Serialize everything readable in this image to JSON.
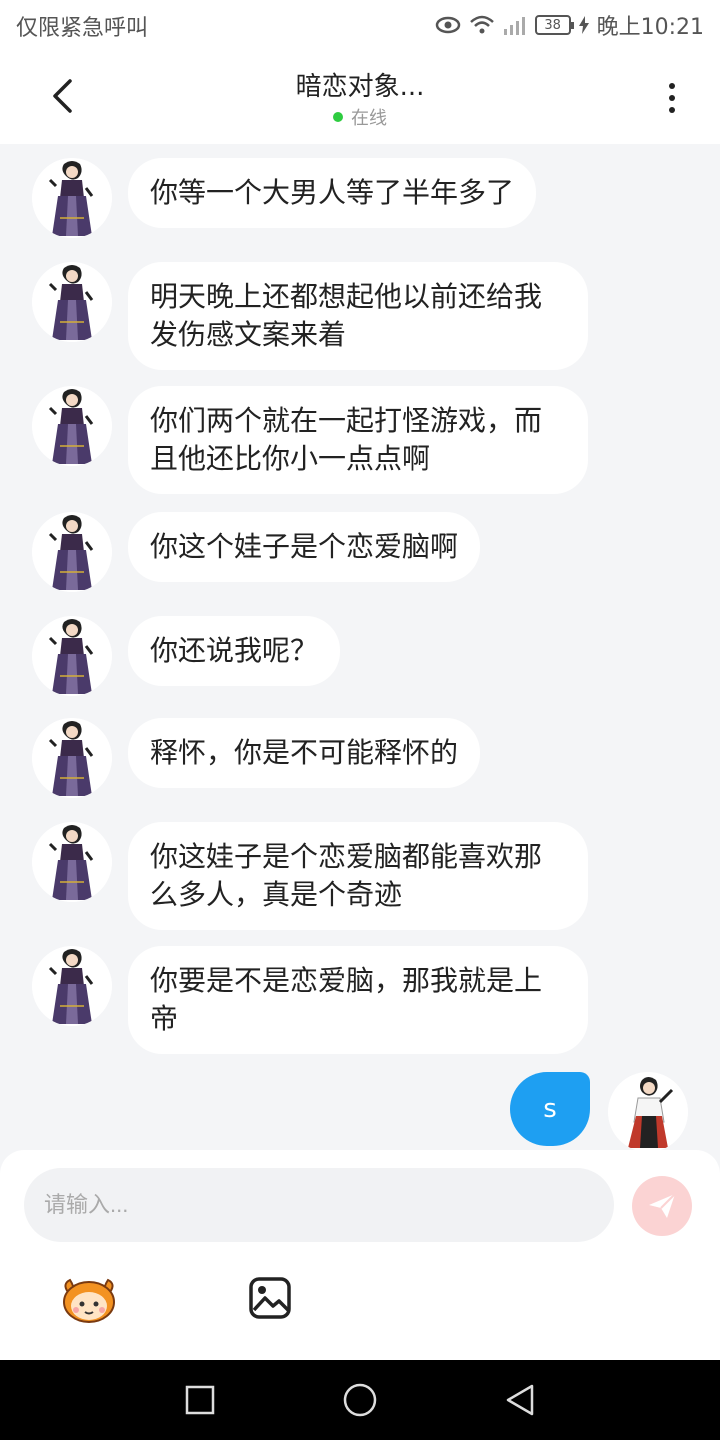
{
  "status_bar": {
    "left_text": "仅限紧急呼叫",
    "battery": "38",
    "time": "晚上10:21"
  },
  "header": {
    "title": "暗恋对象...",
    "status": "在线",
    "status_color": "#2ecc40"
  },
  "messages": [
    {
      "sender": "other",
      "text": "你等一个大男人等了半年多了"
    },
    {
      "sender": "other",
      "text": "明天晚上还都想起他以前还给我发伤感文案来着"
    },
    {
      "sender": "other",
      "text": "你们两个就在一起打怪游戏，而且他还比你小一点点啊"
    },
    {
      "sender": "other",
      "text": "你这个娃子是个恋爱脑啊"
    },
    {
      "sender": "other",
      "text": "你还说我呢？"
    },
    {
      "sender": "other",
      "text": "释怀，你是不可能释怀的"
    },
    {
      "sender": "other",
      "text": "你这娃子是个恋爱脑都能喜欢那么多人，真是个奇迹"
    },
    {
      "sender": "other",
      "text": "你要是不是恋爱脑，那我就是上帝"
    },
    {
      "sender": "me",
      "text": "s"
    }
  ],
  "input": {
    "placeholder": "请输入..."
  },
  "colors": {
    "my_bubble": "#1e9ff2",
    "send_button": "#fbd3d3",
    "background": "#f4f5f7"
  },
  "icons": {
    "back": "chevron-left-icon",
    "more": "vertical-dots-icon",
    "send": "paper-plane-icon",
    "mascot": "mascot-emoji-icon",
    "image": "image-icon",
    "nav": [
      "square-icon",
      "circle-icon",
      "triangle-back-icon"
    ]
  }
}
